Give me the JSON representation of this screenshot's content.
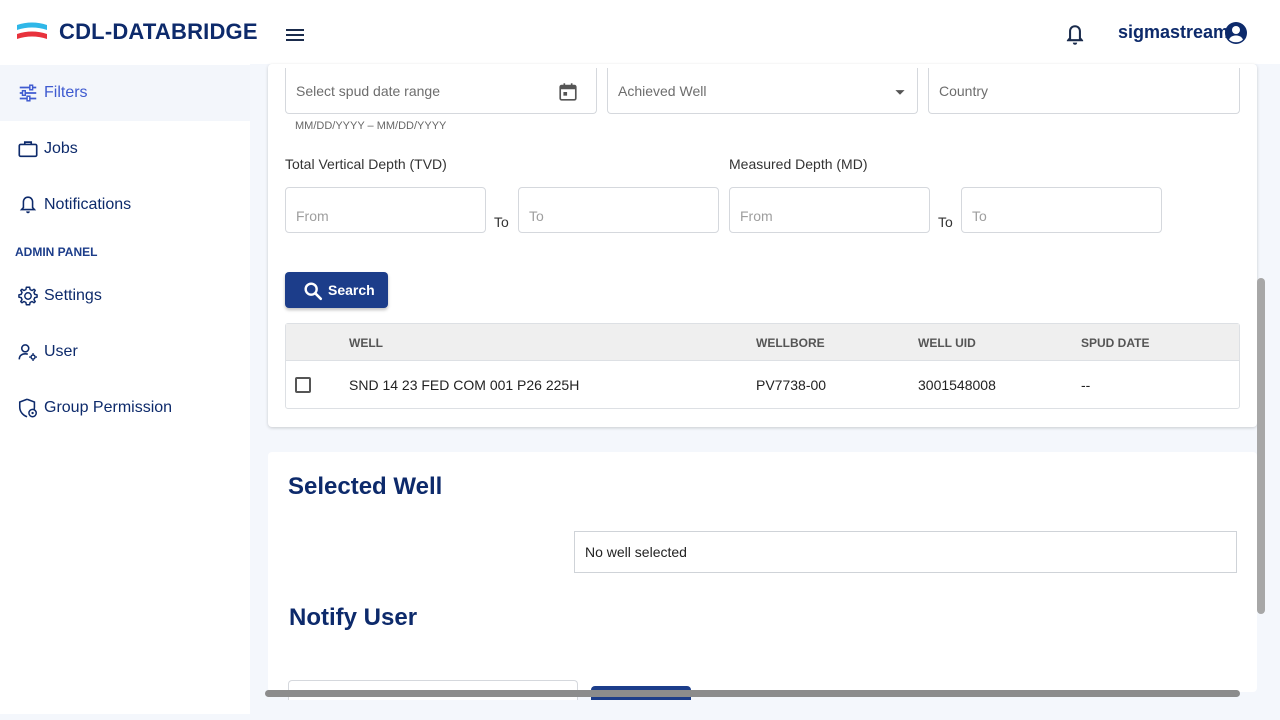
{
  "app": {
    "brand": "CDL-DATABRIDGE",
    "username": "sigmastream",
    "brand_color": "#0d2a6b",
    "accent_color": "#1c3d8a",
    "logo_colors": [
      "#2fb7e8",
      "#e8323c"
    ]
  },
  "sidebar": {
    "items": [
      {
        "label": "Filters",
        "icon": "sliders-icon",
        "active": true
      },
      {
        "label": "Jobs",
        "icon": "briefcase-icon"
      },
      {
        "label": "Notifications",
        "icon": "bell-icon"
      }
    ],
    "admin_label": "ADMIN PANEL",
    "admin_items": [
      {
        "label": "Settings",
        "icon": "gear-icon"
      },
      {
        "label": "User",
        "icon": "user-settings-icon"
      },
      {
        "label": "Group Permission",
        "icon": "shield-settings-icon"
      }
    ]
  },
  "filters": {
    "spud_date_placeholder": "Select spud date range",
    "spud_date_hint": "MM/DD/YYYY – MM/DD/YYYY",
    "achieved_well_placeholder": "Achieved Well",
    "country_placeholder": "Country",
    "tvd_label": "Total Vertical Depth (TVD)",
    "md_label": "Measured Depth (MD)",
    "from_placeholder": "From",
    "to_placeholder": "To",
    "to_label": "To",
    "search_label": "Search"
  },
  "table": {
    "headers": [
      "WELL",
      "WELLBORE",
      "WELL UID",
      "SPUD DATE"
    ],
    "rows": [
      {
        "well": "SND 14 23 FED COM 001 P26 225H",
        "wellbore": "PV7738-00",
        "well_uid": "3001548008",
        "spud_date": "--",
        "checked": false
      }
    ]
  },
  "selected_well": {
    "title": "Selected Well",
    "empty_text": "No well selected"
  },
  "notify_user": {
    "title": "Notify User"
  }
}
